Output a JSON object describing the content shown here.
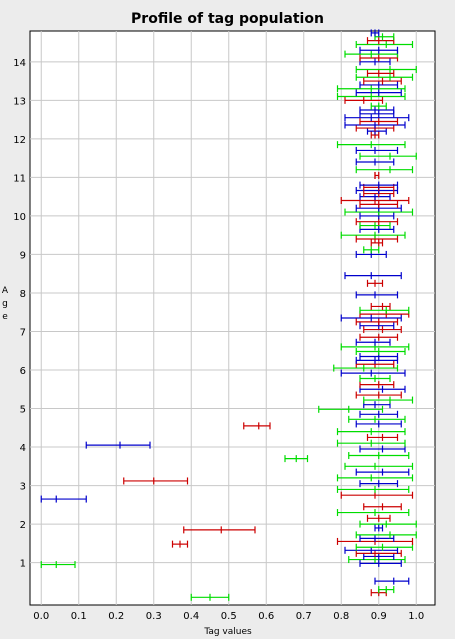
{
  "chart_data": {
    "type": "errorbar-scatter",
    "title": "Profile of tag population",
    "xlabel": "Tag values",
    "ylabel": "Age",
    "xlim": [
      -0.03,
      1.05
    ],
    "ylim": [
      -0.1,
      14.8
    ],
    "xticks": [
      "0.0",
      "0.1",
      "0.2",
      "0.3",
      "0.4",
      "0.5",
      "0.6",
      "0.7",
      "0.8",
      "0.9",
      "1.0"
    ],
    "yticks": [
      "1",
      "2",
      "3",
      "4",
      "5",
      "6",
      "7",
      "8",
      "9",
      "10",
      "11",
      "12",
      "13",
      "14"
    ],
    "grid": true,
    "series_colors": {
      "blue": "#0000cc",
      "red": "#cc0000",
      "green": "#00dd00"
    },
    "segments": [
      {
        "y": 0.1,
        "x1": 0.4,
        "x": 0.45,
        "x2": 0.5,
        "c": "green"
      },
      {
        "y": 0.22,
        "x1": 0.88,
        "x": 0.9,
        "x2": 0.92,
        "c": "red"
      },
      {
        "y": 0.3,
        "x1": 0.9,
        "x": 0.92,
        "x2": 0.94,
        "c": "green"
      },
      {
        "y": 0.52,
        "x1": 0.89,
        "x": 0.94,
        "x2": 0.98,
        "c": "blue"
      },
      {
        "y": 0.95,
        "x1": 0.0,
        "x": 0.04,
        "x2": 0.09,
        "c": "green"
      },
      {
        "y": 0.98,
        "x1": 0.85,
        "x": 0.9,
        "x2": 0.96,
        "c": "blue"
      },
      {
        "y": 1.08,
        "x1": 0.82,
        "x": 0.89,
        "x2": 0.97,
        "c": "green"
      },
      {
        "y": 1.16,
        "x1": 0.86,
        "x": 0.9,
        "x2": 0.94,
        "c": "blue"
      },
      {
        "y": 1.24,
        "x1": 0.84,
        "x": 0.89,
        "x2": 0.96,
        "c": "red"
      },
      {
        "y": 1.32,
        "x1": 0.81,
        "x": 0.88,
        "x2": 0.95,
        "c": "blue"
      },
      {
        "y": 1.4,
        "x1": 0.84,
        "x": 0.91,
        "x2": 0.99,
        "c": "green"
      },
      {
        "y": 1.48,
        "x1": 0.35,
        "x": 0.37,
        "x2": 0.39,
        "c": "red"
      },
      {
        "y": 1.55,
        "x1": 0.79,
        "x": 0.89,
        "x2": 0.99,
        "c": "red"
      },
      {
        "y": 1.63,
        "x1": 0.85,
        "x": 0.89,
        "x2": 0.94,
        "c": "blue"
      },
      {
        "y": 1.72,
        "x1": 0.84,
        "x": 0.93,
        "x2": 1.0,
        "c": "green"
      },
      {
        "y": 1.85,
        "x1": 0.38,
        "x": 0.48,
        "x2": 0.57,
        "c": "red"
      },
      {
        "y": 1.9,
        "x1": 0.89,
        "x": 0.9,
        "x2": 0.91,
        "c": "blue"
      },
      {
        "y": 2.0,
        "x1": 0.85,
        "x": 0.92,
        "x2": 1.0,
        "c": "green"
      },
      {
        "y": 2.15,
        "x1": 0.87,
        "x": 0.9,
        "x2": 0.93,
        "c": "red"
      },
      {
        "y": 2.3,
        "x1": 0.79,
        "x": 0.89,
        "x2": 0.98,
        "c": "green"
      },
      {
        "y": 2.45,
        "x1": 0.86,
        "x": 0.91,
        "x2": 0.96,
        "c": "red"
      },
      {
        "y": 2.65,
        "x1": 0.0,
        "x": 0.04,
        "x2": 0.12,
        "c": "blue"
      },
      {
        "y": 2.75,
        "x1": 0.8,
        "x": 0.89,
        "x2": 0.99,
        "c": "red"
      },
      {
        "y": 2.9,
        "x1": 0.79,
        "x": 0.89,
        "x2": 0.98,
        "c": "green"
      },
      {
        "y": 3.05,
        "x1": 0.85,
        "x": 0.9,
        "x2": 0.95,
        "c": "blue"
      },
      {
        "y": 3.12,
        "x1": 0.22,
        "x": 0.3,
        "x2": 0.39,
        "c": "red"
      },
      {
        "y": 3.2,
        "x1": 0.79,
        "x": 0.88,
        "x2": 0.99,
        "c": "green"
      },
      {
        "y": 3.35,
        "x1": 0.84,
        "x": 0.91,
        "x2": 0.98,
        "c": "blue"
      },
      {
        "y": 3.5,
        "x1": 0.81,
        "x": 0.89,
        "x2": 0.99,
        "c": "green"
      },
      {
        "y": 3.7,
        "x1": 0.65,
        "x": 0.68,
        "x2": 0.71,
        "c": "green"
      },
      {
        "y": 3.78,
        "x1": 0.82,
        "x": 0.9,
        "x2": 0.98,
        "c": "green"
      },
      {
        "y": 3.95,
        "x1": 0.85,
        "x": 0.91,
        "x2": 0.97,
        "c": "blue"
      },
      {
        "y": 4.05,
        "x1": 0.12,
        "x": 0.21,
        "x2": 0.29,
        "c": "blue"
      },
      {
        "y": 4.1,
        "x1": 0.79,
        "x": 0.88,
        "x2": 0.97,
        "c": "green"
      },
      {
        "y": 4.25,
        "x1": 0.87,
        "x": 0.91,
        "x2": 0.95,
        "c": "red"
      },
      {
        "y": 4.4,
        "x1": 0.79,
        "x": 0.88,
        "x2": 0.97,
        "c": "green"
      },
      {
        "y": 4.55,
        "x1": 0.54,
        "x": 0.58,
        "x2": 0.61,
        "c": "red"
      },
      {
        "y": 4.6,
        "x1": 0.84,
        "x": 0.9,
        "x2": 0.96,
        "c": "blue"
      },
      {
        "y": 4.72,
        "x1": 0.82,
        "x": 0.89,
        "x2": 0.97,
        "c": "green"
      },
      {
        "y": 4.85,
        "x1": 0.85,
        "x": 0.9,
        "x2": 0.95,
        "c": "blue"
      },
      {
        "y": 4.98,
        "x1": 0.74,
        "x": 0.82,
        "x2": 0.91,
        "c": "green"
      },
      {
        "y": 5.1,
        "x1": 0.86,
        "x": 0.89,
        "x2": 0.93,
        "c": "blue"
      },
      {
        "y": 5.22,
        "x1": 0.86,
        "x": 0.93,
        "x2": 0.99,
        "c": "green"
      },
      {
        "y": 5.35,
        "x1": 0.84,
        "x": 0.9,
        "x2": 0.96,
        "c": "red"
      },
      {
        "y": 5.5,
        "x1": 0.85,
        "x": 0.91,
        "x2": 0.97,
        "c": "blue"
      },
      {
        "y": 5.62,
        "x1": 0.85,
        "x": 0.9,
        "x2": 0.94,
        "c": "red"
      },
      {
        "y": 5.78,
        "x1": 0.85,
        "x": 0.89,
        "x2": 0.93,
        "c": "green"
      },
      {
        "y": 5.92,
        "x1": 0.8,
        "x": 0.88,
        "x2": 0.97,
        "c": "blue"
      },
      {
        "y": 6.05,
        "x1": 0.78,
        "x": 0.86,
        "x2": 0.95,
        "c": "green"
      },
      {
        "y": 6.15,
        "x1": 0.84,
        "x": 0.89,
        "x2": 0.94,
        "c": "red"
      },
      {
        "y": 6.25,
        "x1": 0.84,
        "x": 0.89,
        "x2": 0.95,
        "c": "blue"
      },
      {
        "y": 6.35,
        "x1": 0.85,
        "x": 0.9,
        "x2": 0.95,
        "c": "blue"
      },
      {
        "y": 6.48,
        "x1": 0.84,
        "x": 0.9,
        "x2": 0.97,
        "c": "green"
      },
      {
        "y": 6.6,
        "x1": 0.8,
        "x": 0.89,
        "x2": 0.98,
        "c": "green"
      },
      {
        "y": 6.72,
        "x1": 0.84,
        "x": 0.89,
        "x2": 0.93,
        "c": "blue"
      },
      {
        "y": 6.85,
        "x1": 0.85,
        "x": 0.9,
        "x2": 0.95,
        "c": "red"
      },
      {
        "y": 7.05,
        "x1": 0.86,
        "x": 0.91,
        "x2": 0.96,
        "c": "red"
      },
      {
        "y": 7.15,
        "x1": 0.85,
        "x": 0.9,
        "x2": 0.94,
        "c": "blue"
      },
      {
        "y": 7.25,
        "x1": 0.84,
        "x": 0.9,
        "x2": 0.95,
        "c": "red"
      },
      {
        "y": 7.35,
        "x1": 0.8,
        "x": 0.88,
        "x2": 0.96,
        "c": "blue"
      },
      {
        "y": 7.45,
        "x1": 0.85,
        "x": 0.92,
        "x2": 0.98,
        "c": "red"
      },
      {
        "y": 7.55,
        "x1": 0.85,
        "x": 0.92,
        "x2": 0.98,
        "c": "green"
      },
      {
        "y": 7.65,
        "x1": 0.88,
        "x": 0.91,
        "x2": 0.93,
        "c": "red"
      },
      {
        "y": 7.95,
        "x1": 0.84,
        "x": 0.89,
        "x2": 0.95,
        "c": "blue"
      },
      {
        "y": 8.25,
        "x1": 0.87,
        "x": 0.89,
        "x2": 0.91,
        "c": "red"
      },
      {
        "y": 8.45,
        "x1": 0.81,
        "x": 0.88,
        "x2": 0.96,
        "c": "blue"
      },
      {
        "y": 9.0,
        "x1": 0.84,
        "x": 0.88,
        "x2": 0.92,
        "c": "blue"
      },
      {
        "y": 9.12,
        "x1": 0.86,
        "x": 0.88,
        "x2": 0.9,
        "c": "green"
      },
      {
        "y": 9.3,
        "x1": 0.88,
        "x": 0.9,
        "x2": 0.91,
        "c": "red"
      },
      {
        "y": 9.4,
        "x1": 0.84,
        "x": 0.89,
        "x2": 0.95,
        "c": "red"
      },
      {
        "y": 9.5,
        "x1": 0.8,
        "x": 0.89,
        "x2": 0.97,
        "c": "green"
      },
      {
        "y": 9.65,
        "x1": 0.85,
        "x": 0.9,
        "x2": 0.94,
        "c": "blue"
      },
      {
        "y": 9.75,
        "x1": 0.85,
        "x": 0.89,
        "x2": 0.93,
        "c": "green"
      },
      {
        "y": 9.85,
        "x1": 0.84,
        "x": 0.9,
        "x2": 0.95,
        "c": "red"
      },
      {
        "y": 10.0,
        "x1": 0.85,
        "x": 0.9,
        "x2": 0.94,
        "c": "blue"
      },
      {
        "y": 10.1,
        "x1": 0.81,
        "x": 0.9,
        "x2": 0.99,
        "c": "green"
      },
      {
        "y": 10.2,
        "x1": 0.84,
        "x": 0.9,
        "x2": 0.96,
        "c": "blue"
      },
      {
        "y": 10.3,
        "x1": 0.85,
        "x": 0.9,
        "x2": 0.95,
        "c": "red"
      },
      {
        "y": 10.4,
        "x1": 0.8,
        "x": 0.89,
        "x2": 0.98,
        "c": "red"
      },
      {
        "y": 10.5,
        "x1": 0.85,
        "x": 0.89,
        "x2": 0.93,
        "c": "blue"
      },
      {
        "y": 10.58,
        "x1": 0.86,
        "x": 0.9,
        "x2": 0.94,
        "c": "red"
      },
      {
        "y": 10.66,
        "x1": 0.84,
        "x": 0.9,
        "x2": 0.95,
        "c": "blue"
      },
      {
        "y": 10.74,
        "x1": 0.86,
        "x": 0.9,
        "x2": 0.94,
        "c": "red"
      },
      {
        "y": 10.8,
        "x1": 0.85,
        "x": 0.9,
        "x2": 0.95,
        "c": "blue"
      },
      {
        "y": 11.05,
        "x1": 0.89,
        "x": 0.89,
        "x2": 0.9,
        "c": "red"
      },
      {
        "y": 11.2,
        "x1": 0.84,
        "x": 0.93,
        "x2": 0.99,
        "c": "green"
      },
      {
        "y": 11.4,
        "x1": 0.84,
        "x": 0.89,
        "x2": 0.94,
        "c": "blue"
      },
      {
        "y": 11.55,
        "x1": 0.85,
        "x": 0.93,
        "x2": 1.0,
        "c": "green"
      },
      {
        "y": 11.7,
        "x1": 0.84,
        "x": 0.89,
        "x2": 0.95,
        "c": "blue"
      },
      {
        "y": 11.85,
        "x1": 0.79,
        "x": 0.88,
        "x2": 0.97,
        "c": "green"
      },
      {
        "y": 12.1,
        "x1": 0.88,
        "x": 0.89,
        "x2": 0.9,
        "c": "red"
      },
      {
        "y": 12.2,
        "x1": 0.87,
        "x": 0.89,
        "x2": 0.92,
        "c": "blue"
      },
      {
        "y": 12.28,
        "x1": 0.84,
        "x": 0.89,
        "x2": 0.94,
        "c": "red"
      },
      {
        "y": 12.36,
        "x1": 0.81,
        "x": 0.89,
        "x2": 0.97,
        "c": "blue"
      },
      {
        "y": 12.45,
        "x1": 0.85,
        "x": 0.9,
        "x2": 0.95,
        "c": "red"
      },
      {
        "y": 12.55,
        "x1": 0.81,
        "x": 0.88,
        "x2": 0.98,
        "c": "blue"
      },
      {
        "y": 12.65,
        "x1": 0.85,
        "x": 0.9,
        "x2": 0.94,
        "c": "blue"
      },
      {
        "y": 12.75,
        "x1": 0.85,
        "x": 0.89,
        "x2": 0.94,
        "c": "blue"
      },
      {
        "y": 12.85,
        "x1": 0.88,
        "x": 0.9,
        "x2": 0.92,
        "c": "green"
      },
      {
        "y": 13.0,
        "x1": 0.81,
        "x": 0.86,
        "x2": 0.91,
        "c": "red"
      },
      {
        "y": 13.1,
        "x1": 0.79,
        "x": 0.88,
        "x2": 0.97,
        "c": "green"
      },
      {
        "y": 13.2,
        "x1": 0.84,
        "x": 0.9,
        "x2": 0.96,
        "c": "blue"
      },
      {
        "y": 13.3,
        "x1": 0.79,
        "x": 0.88,
        "x2": 0.97,
        "c": "green"
      },
      {
        "y": 13.4,
        "x1": 0.85,
        "x": 0.9,
        "x2": 0.95,
        "c": "blue"
      },
      {
        "y": 13.5,
        "x1": 0.86,
        "x": 0.91,
        "x2": 0.96,
        "c": "red"
      },
      {
        "y": 13.6,
        "x1": 0.84,
        "x": 0.93,
        "x2": 0.99,
        "c": "green"
      },
      {
        "y": 13.7,
        "x1": 0.87,
        "x": 0.9,
        "x2": 0.94,
        "c": "red"
      },
      {
        "y": 13.8,
        "x1": 0.84,
        "x": 0.93,
        "x2": 1.0,
        "c": "green"
      },
      {
        "y": 14.0,
        "x1": 0.85,
        "x": 0.89,
        "x2": 0.93,
        "c": "blue"
      },
      {
        "y": 14.1,
        "x1": 0.85,
        "x": 0.9,
        "x2": 0.95,
        "c": "red"
      },
      {
        "y": 14.2,
        "x1": 0.81,
        "x": 0.88,
        "x2": 0.95,
        "c": "green"
      },
      {
        "y": 14.3,
        "x1": 0.85,
        "x": 0.9,
        "x2": 0.95,
        "c": "blue"
      },
      {
        "y": 14.45,
        "x1": 0.84,
        "x": 0.92,
        "x2": 0.99,
        "c": "green"
      },
      {
        "y": 14.55,
        "x1": 0.87,
        "x": 0.9,
        "x2": 0.94,
        "c": "red"
      },
      {
        "y": 14.65,
        "x1": 0.89,
        "x": 0.91,
        "x2": 0.94,
        "c": "green"
      },
      {
        "y": 14.75,
        "x1": 0.88,
        "x": 0.89,
        "x2": 0.9,
        "c": "blue"
      }
    ]
  }
}
